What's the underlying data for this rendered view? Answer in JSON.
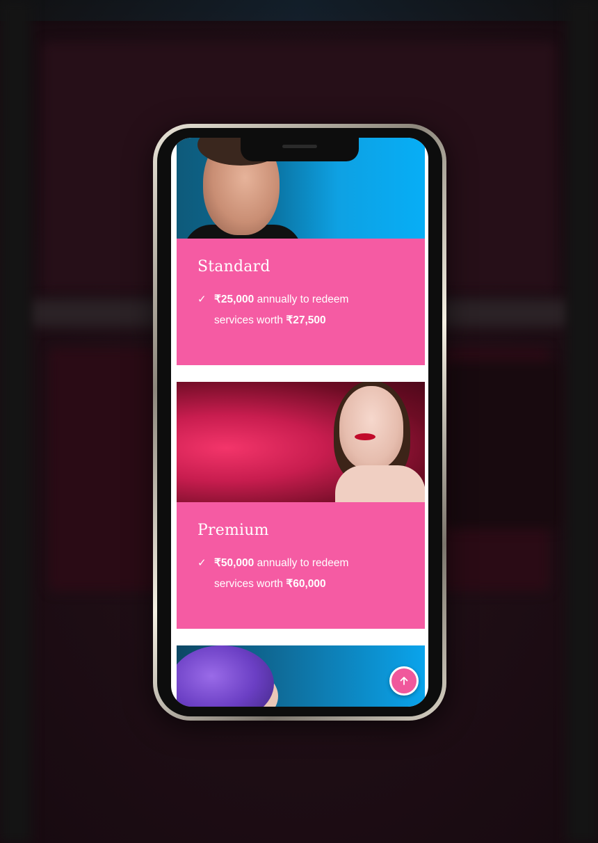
{
  "colors": {
    "card_pink": "#f55ba3",
    "scroll_button": "#f0589c",
    "background": "#1c0d14"
  },
  "plans": [
    {
      "title": "Standard",
      "amount": "₹25,000",
      "line1_rest": " annually to redeem",
      "line2_prefix": "services worth ",
      "worth": "₹27,500",
      "icon": "check-icon"
    },
    {
      "title": "Premium",
      "amount": "₹50,000",
      "line1_rest": " annually to redeem",
      "line2_prefix": "services worth ",
      "worth": "₹60,000",
      "icon": "check-icon"
    }
  ],
  "scroll_top": {
    "icon": "arrow-up-icon"
  }
}
